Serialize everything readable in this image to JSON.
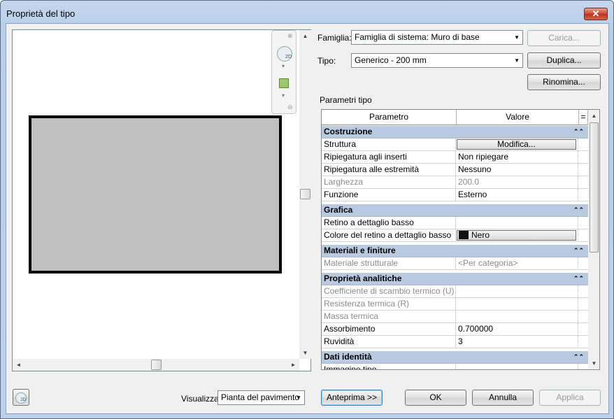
{
  "window": {
    "title": "Proprietà del tipo",
    "close_glyph": "✕"
  },
  "preview": {
    "nav_icon_2d": "2D",
    "scroll_up": "▲",
    "scroll_down": "▼",
    "scroll_left": "◄",
    "scroll_right": "►",
    "nav_close": "⊗",
    "nav_down": "▾",
    "nav_end": "⊖"
  },
  "family": {
    "label": "Famiglia:",
    "value": "Famiglia di sistema: Muro di base",
    "load_button": "Carica..."
  },
  "type": {
    "label": "Tipo:",
    "value": "Generico - 200 mm",
    "duplicate_button": "Duplica...",
    "rename_button": "Rinomina..."
  },
  "params": {
    "title": "Parametri tipo",
    "col_param": "Parametro",
    "col_value": "Valore",
    "col_eq": "=",
    "groups": {
      "costruzione": "Costruzione",
      "grafica": "Grafica",
      "materiali": "Materiali e finiture",
      "analitiche": "Proprietà analitiche",
      "identita": "Dati identità"
    },
    "rows": {
      "struttura": {
        "name": "Struttura",
        "value": "Modifica..."
      },
      "rip_inserti": {
        "name": "Ripiegatura agli inserti",
        "value": "Non ripiegare"
      },
      "rip_estremita": {
        "name": "Ripiegatura alle estremità",
        "value": "Nessuno"
      },
      "larghezza": {
        "name": "Larghezza",
        "value": "200.0"
      },
      "funzione": {
        "name": "Funzione",
        "value": "Esterno"
      },
      "retino": {
        "name": "Retino a dettaglio basso",
        "value": ""
      },
      "colore_retino": {
        "name": "Colore del retino a dettaglio basso",
        "value": "Nero"
      },
      "mat_strutturale": {
        "name": "Materiale strutturale",
        "value": "<Per categoria>"
      },
      "coeff": {
        "name": "Coefficiente di scambio termico (U)",
        "value": ""
      },
      "resistenza": {
        "name": "Resistenza termica (R)",
        "value": ""
      },
      "massa": {
        "name": "Massa termica",
        "value": ""
      },
      "assorbimento": {
        "name": "Assorbimento",
        "value": "0.700000"
      },
      "ruvidita": {
        "name": "Ruvidità",
        "value": "3"
      },
      "immagine": {
        "name": "Immagine tipo",
        "value": ""
      }
    }
  },
  "footer": {
    "view_label": "Visualizza:",
    "view_value": "Pianta del pavimento",
    "preview_button": "Anteprima >>",
    "ok_button": "OK",
    "cancel_button": "Annulla",
    "apply_button": "Applica"
  }
}
